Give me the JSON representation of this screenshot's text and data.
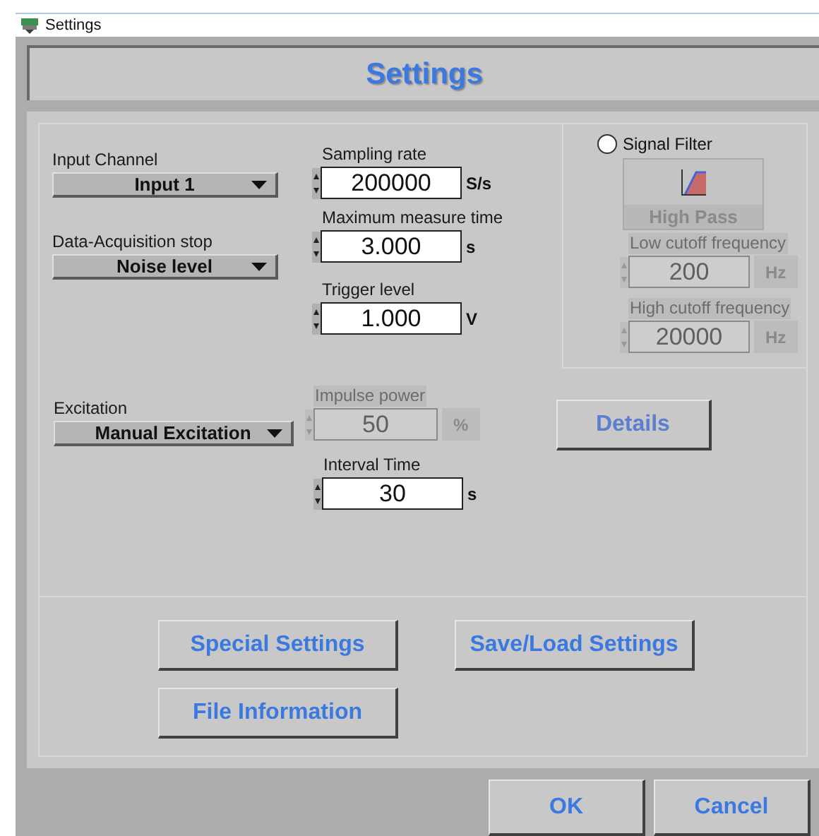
{
  "window": {
    "title": "Settings"
  },
  "header": {
    "title": "Settings"
  },
  "input_channel": {
    "label": "Input Channel",
    "value": "Input 1"
  },
  "acquisition_stop": {
    "label": "Data-Acquisition stop",
    "value": "Noise level"
  },
  "sampling_rate": {
    "label": "Sampling rate",
    "value": "200000",
    "unit": "S/s",
    "disabled": false
  },
  "max_measure_time": {
    "label": "Maximum measure time",
    "value": "3.000",
    "unit": "s",
    "disabled": false
  },
  "trigger_level": {
    "label": "Trigger level",
    "value": "1.000",
    "unit": "V",
    "disabled": false
  },
  "signal_filter": {
    "label": "Signal Filter",
    "on": false,
    "filter_type": "High Pass",
    "low_cutoff": {
      "label": "Low cutoff frequency",
      "value": "200",
      "unit": "Hz",
      "disabled": true
    },
    "high_cutoff": {
      "label": "High cutoff frequency",
      "value": "20000",
      "unit": "Hz",
      "disabled": true
    }
  },
  "excitation": {
    "label": "Excitation",
    "value": "Manual Excitation"
  },
  "impulse_power": {
    "label": "Impulse power",
    "value": "50",
    "unit": "%",
    "disabled": true
  },
  "interval_time": {
    "label": "Interval Time",
    "value": "30",
    "unit": "s",
    "disabled": false
  },
  "details_button": {
    "label": "Details",
    "disabled": true
  },
  "panel_buttons": [
    {
      "label": "Special Settings"
    },
    {
      "label": "Save/Load Settings"
    },
    {
      "label": "File Information"
    }
  ],
  "dialog_buttons": [
    {
      "label": "OK"
    },
    {
      "label": "Cancel"
    }
  ]
}
